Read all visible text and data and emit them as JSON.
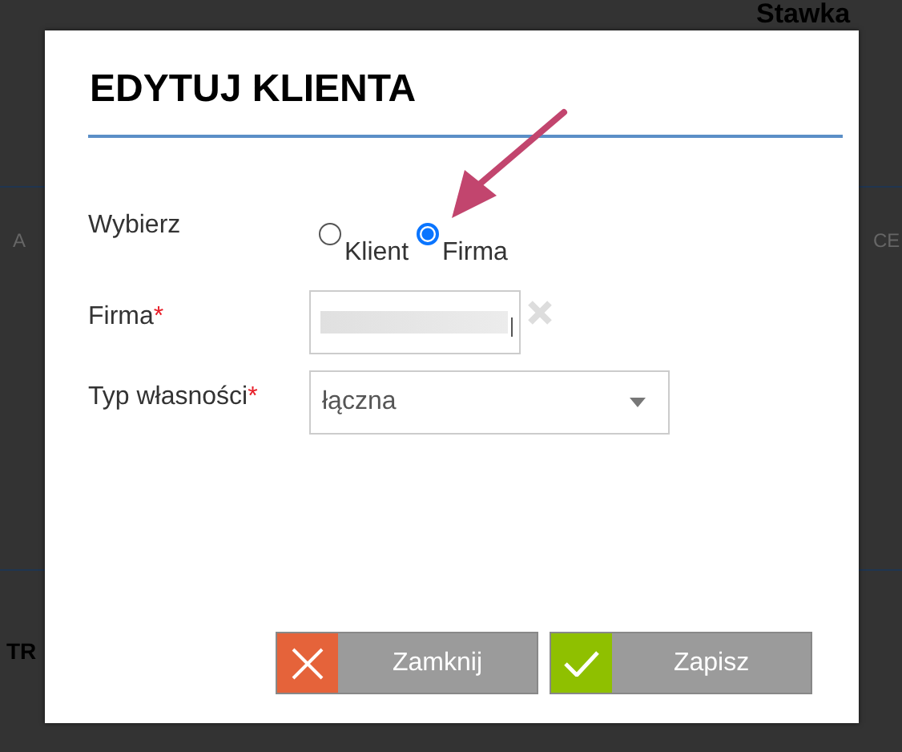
{
  "background": {
    "heading": "Stawka",
    "column_left": "A",
    "column_right": "CE",
    "section": "TR"
  },
  "dialog": {
    "title": "EDYTUJ KLIENTA",
    "choice": {
      "label": "Wybierz",
      "options": [
        {
          "label": "Klient",
          "selected": false
        },
        {
          "label": "Firma",
          "selected": true
        }
      ]
    },
    "fields": [
      {
        "kind": "text",
        "label": "Firma",
        "required_mark": "*",
        "redacted": true
      },
      {
        "kind": "select",
        "label": "Typ własności",
        "required_mark": "*",
        "value": "łączna"
      }
    ],
    "buttons": [
      {
        "kind": "close",
        "label": "Zamknij"
      },
      {
        "kind": "save",
        "label": "Zapisz"
      }
    ]
  }
}
